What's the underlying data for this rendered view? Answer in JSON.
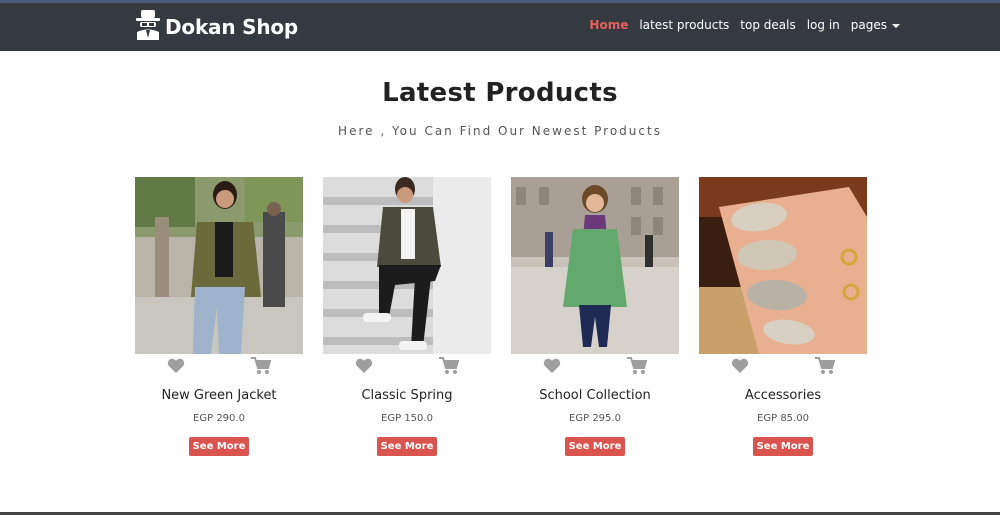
{
  "header": {
    "brand_name": "Dokan Shop",
    "logo_icon": "spy-hat-icon",
    "nav": [
      {
        "label": "Home",
        "active": true
      },
      {
        "label": "latest products",
        "active": false
      },
      {
        "label": "top deals",
        "active": false
      },
      {
        "label": "log in",
        "active": false
      },
      {
        "label": "pages",
        "active": false,
        "dropdown": true
      }
    ]
  },
  "main": {
    "title": "Latest Products",
    "subtitle": "Here , You Can Find Our Newest Products",
    "see_more_label": "See More",
    "products": [
      {
        "name": "New Green Jacket",
        "price": "EGP 290.0",
        "image": "woman-green-jacket"
      },
      {
        "name": "Classic Spring",
        "price": "EGP 150.0",
        "image": "man-camo-jacket-stairs"
      },
      {
        "name": "School Collection",
        "price": "EGP 295.0",
        "image": "girl-green-coat"
      },
      {
        "name": "Accessories",
        "price": "EGP 85.00",
        "image": "nails-rings"
      }
    ]
  },
  "colors": {
    "navbar_bg": "#343a40",
    "active_nav": "#e9605c",
    "button_bg": "#d9534f",
    "icon_gray": "#9e9e9e"
  }
}
